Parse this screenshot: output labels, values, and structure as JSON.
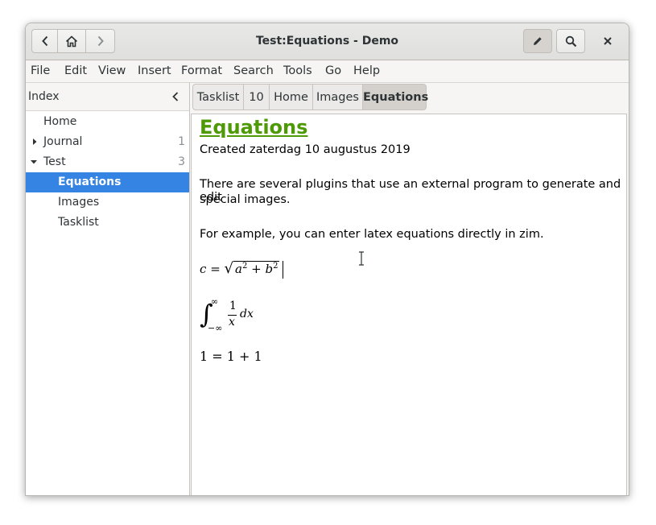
{
  "window": {
    "title": "Test:Equations - Demo"
  },
  "titlebar": {
    "icons": {
      "back": "chevron-left-icon",
      "home": "home-icon",
      "forward": "chevron-right-icon",
      "edit": "pencil-icon",
      "search": "search-icon",
      "close": "close-icon"
    }
  },
  "menubar": {
    "items": [
      "File",
      "Edit",
      "View",
      "Insert",
      "Format",
      "Search",
      "Tools",
      "Go",
      "Help"
    ]
  },
  "sidebar": {
    "title": "Index",
    "items": [
      {
        "label": "Home",
        "count": ""
      },
      {
        "label": "Journal",
        "count": "1"
      },
      {
        "label": "Test",
        "count": "3"
      },
      {
        "label": "Equations",
        "count": ""
      },
      {
        "label": "Images",
        "count": ""
      },
      {
        "label": "Tasklist",
        "count": ""
      }
    ]
  },
  "tabs": [
    {
      "label": "Tasklist"
    },
    {
      "label": "10"
    },
    {
      "label": "Home"
    },
    {
      "label": "Images"
    },
    {
      "label": "Equations"
    }
  ],
  "page": {
    "heading": "Equations",
    "created": "Created zaterdag 10 augustus 2019",
    "para1_line1": "There are several plugins that use an external program to generate and edit",
    "para1_line2": "special images.",
    "para2": "For example, you can enter latex equations directly in zim.",
    "eq1": {
      "lhs": "c",
      "eq": "=",
      "sqrt": "√",
      "a": "a",
      "two": "2",
      "plus": "+",
      "b": "b"
    },
    "eq2": {
      "integral": "∫",
      "upper": "∞",
      "lower": "−∞",
      "num": "1",
      "den": "x",
      "dx": "dx"
    },
    "eq3": {
      "text": "1 = 1 + 1"
    }
  },
  "colors": {
    "accent": "#3584e4",
    "heading": "#4e9a06"
  }
}
